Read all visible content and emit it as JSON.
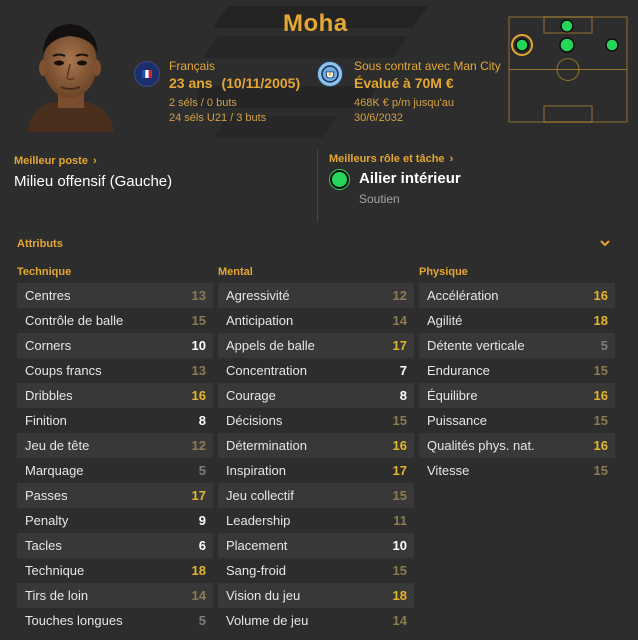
{
  "player": {
    "name": "Moha",
    "nationality": "Français",
    "age": "23 ans",
    "dob": "(10/11/2005)",
    "caps": "2 séls / 0 buts",
    "u21_caps": "24 séls U21 / 3 buts",
    "contract": "Sous contrat avec Man City",
    "value": "Évalué à 70M €",
    "wage": "468K € p/m jusqu'au",
    "contract_end": "30/6/2032"
  },
  "best_position": {
    "label": "Meilleur poste",
    "value": "Milieu offensif (Gauche)"
  },
  "best_role": {
    "label": "Meilleurs rôle et tâche",
    "role": "Ailier intérieur",
    "duty": "Soutien"
  },
  "attributes": {
    "title": "Attributs",
    "columns": [
      {
        "title": "Technique",
        "rows": [
          {
            "label": "Centres",
            "value": 13
          },
          {
            "label": "Contrôle de balle",
            "value": 15
          },
          {
            "label": "Corners",
            "value": 10
          },
          {
            "label": "Coups francs",
            "value": 13
          },
          {
            "label": "Dribbles",
            "value": 16
          },
          {
            "label": "Finition",
            "value": 8
          },
          {
            "label": "Jeu de tête",
            "value": 12
          },
          {
            "label": "Marquage",
            "value": 5
          },
          {
            "label": "Passes",
            "value": 17
          },
          {
            "label": "Penalty",
            "value": 9
          },
          {
            "label": "Tacles",
            "value": 6
          },
          {
            "label": "Technique",
            "value": 18
          },
          {
            "label": "Tirs de loin",
            "value": 14
          },
          {
            "label": "Touches longues",
            "value": 5
          }
        ]
      },
      {
        "title": "Mental",
        "rows": [
          {
            "label": "Agressivité",
            "value": 12
          },
          {
            "label": "Anticipation",
            "value": 14
          },
          {
            "label": "Appels de balle",
            "value": 17
          },
          {
            "label": "Concentration",
            "value": 7
          },
          {
            "label": "Courage",
            "value": 8
          },
          {
            "label": "Décisions",
            "value": 15
          },
          {
            "label": "Détermination",
            "value": 16
          },
          {
            "label": "Inspiration",
            "value": 17
          },
          {
            "label": "Jeu collectif",
            "value": 15
          },
          {
            "label": "Leadership",
            "value": 11
          },
          {
            "label": "Placement",
            "value": 10
          },
          {
            "label": "Sang-froid",
            "value": 15
          },
          {
            "label": "Vision du jeu",
            "value": 18
          },
          {
            "label": "Volume de jeu",
            "value": 14
          }
        ]
      },
      {
        "title": "Physique",
        "rows": [
          {
            "label": "Accélération",
            "value": 16
          },
          {
            "label": "Agilité",
            "value": 18
          },
          {
            "label": "Détente verticale",
            "value": 5
          },
          {
            "label": "Endurance",
            "value": 15
          },
          {
            "label": "Équilibre",
            "value": 16
          },
          {
            "label": "Puissance",
            "value": 15
          },
          {
            "label": "Qualités phys. nat.",
            "value": 16
          },
          {
            "label": "Vitesse",
            "value": 15
          }
        ]
      }
    ]
  },
  "colors": {
    "accent": "#e5a733",
    "role_dot": "#26d65b",
    "value_high": "#e5b52b",
    "value_mid": "#8c7b52",
    "value_low": "#7d7d7d",
    "value_white": "#ffffff"
  },
  "icons": {
    "flag": "france-federation-badge",
    "club": "man-city-badge",
    "chevron": "chevron-down-icon",
    "pitch": "position-pitch-diagram"
  }
}
